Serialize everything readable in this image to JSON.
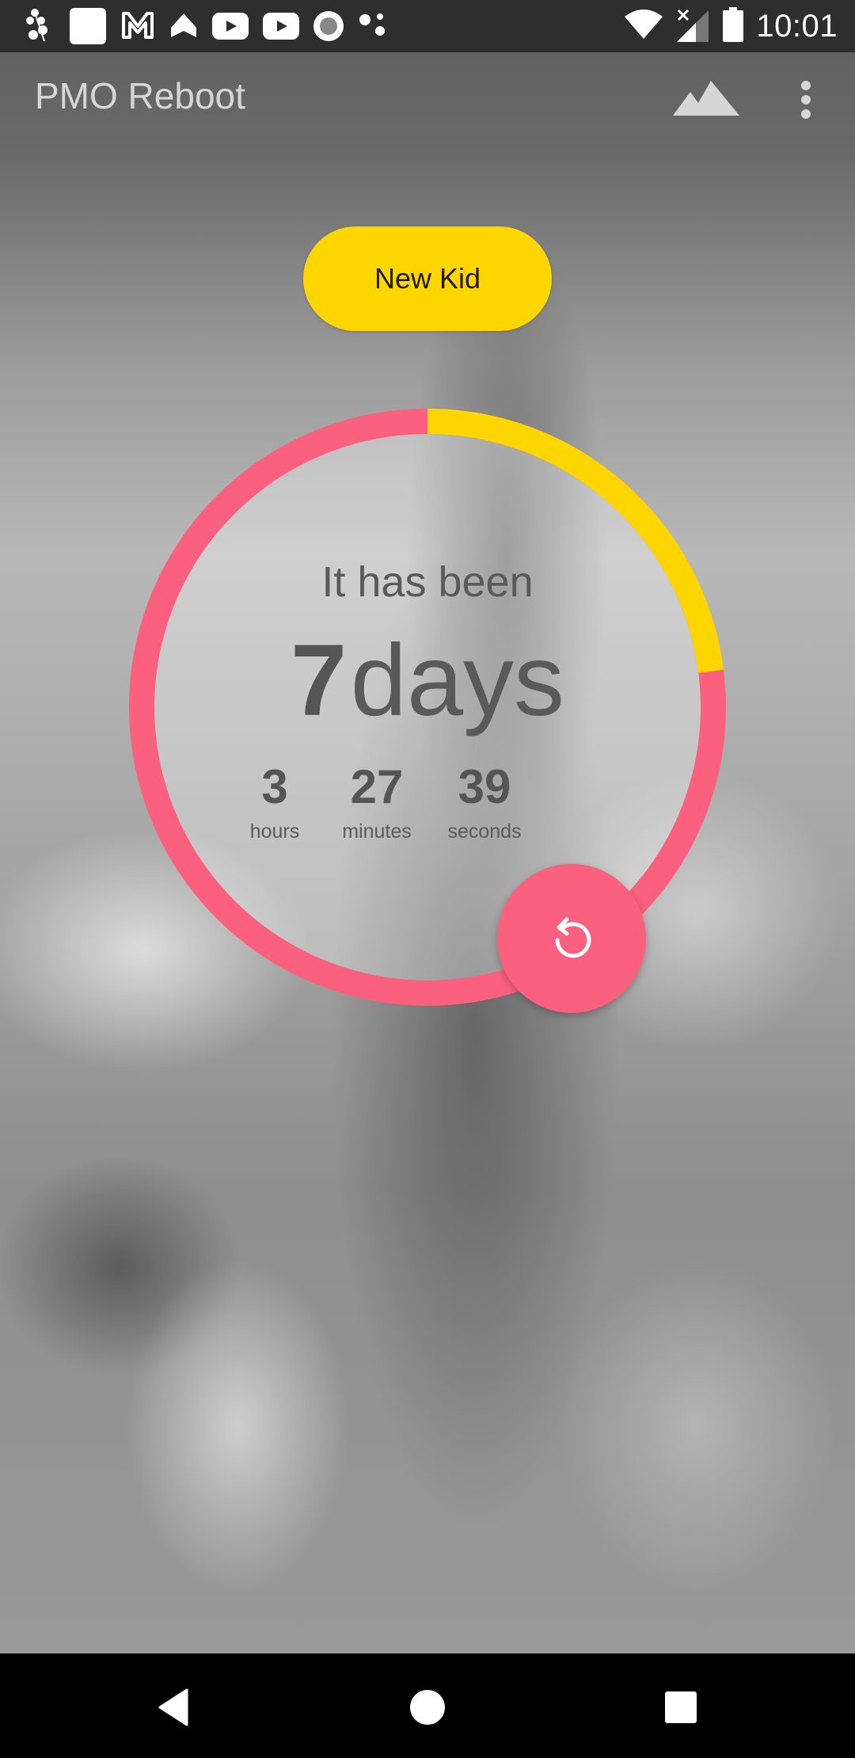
{
  "status_bar": {
    "left_icons": [
      "plant-notification-icon",
      "square-app-icon",
      "gmail-icon",
      "navigation-app-icon",
      "youtube-icon",
      "youtube-icon",
      "record-icon",
      "dots-app-icon"
    ],
    "right_icons": [
      "wifi-icon",
      "cellular-no-signal-icon",
      "battery-icon"
    ],
    "time": "10:01"
  },
  "app_bar": {
    "title": "PMO Reboot",
    "actions": [
      "mountain-icon",
      "more-vert-icon"
    ]
  },
  "new_kid_button": {
    "label": "New Kid"
  },
  "counter": {
    "heading": "It has been",
    "days_value": "7",
    "days_unit": "days",
    "hours_value": "3",
    "hours_label": "hours",
    "minutes_value": "27",
    "minutes_label": "minutes",
    "seconds_value": "39",
    "seconds_label": "seconds",
    "progress_fraction": 0.23
  },
  "reset_button": {
    "icon": "reset-icon"
  },
  "colors": {
    "accent_yellow": "#ffd600",
    "accent_pink": "#fb617e",
    "status_bar_bg": "#2e2e2e"
  },
  "nav_bar": {
    "buttons": [
      "back-icon",
      "home-icon",
      "recents-icon"
    ]
  }
}
